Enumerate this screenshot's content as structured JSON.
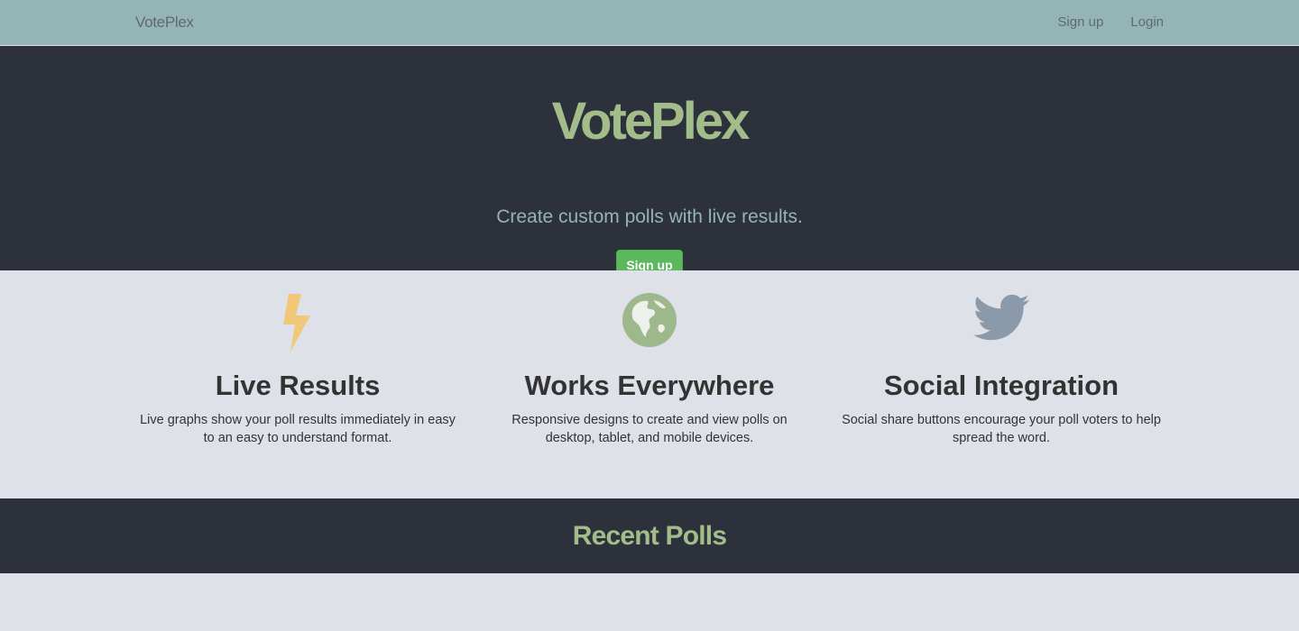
{
  "navbar": {
    "brand": "VotePlex",
    "links": [
      {
        "label": "Sign up"
      },
      {
        "label": "Login"
      }
    ]
  },
  "hero": {
    "title": "VotePlex",
    "subtitle": "Create custom polls with live results.",
    "button_label": "Sign up"
  },
  "features": [
    {
      "icon": "lightning-icon",
      "title": "Live Results",
      "description": "Live graphs show your poll results immediately in easy to an easy to understand format."
    },
    {
      "icon": "globe-icon",
      "title": "Works Everywhere",
      "description": "Responsive designs to create and view polls on desktop, tablet, and mobile devices."
    },
    {
      "icon": "twitter-icon",
      "title": "Social Integration",
      "description": "Social share buttons encourage your poll voters to help spread the word."
    }
  ],
  "recent": {
    "heading": "Recent Polls"
  },
  "colors": {
    "navbar_bg": "#95b5b4",
    "dark_bg": "#2d313b",
    "light_bg": "#dee1e8",
    "accent_green": "#a3bd8a",
    "button_green": "#5cb85c",
    "lightning_yellow": "#f0c878",
    "twitter_gray": "#8a9aaa"
  }
}
